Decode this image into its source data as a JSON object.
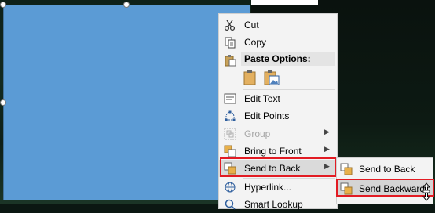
{
  "menu": {
    "cut": "Cut",
    "copy": "Copy",
    "paste_options": "Paste Options:",
    "edit_text": "Edit Text",
    "edit_points": "Edit Points",
    "group": "Group",
    "bring_to_front": "Bring to Front",
    "send_to_back": "Send to Back",
    "hyperlink": "Hyperlink...",
    "smart_lookup": "Smart Lookup"
  },
  "submenu": {
    "send_to_back": "Send to Back",
    "send_backward": "Send Backward"
  },
  "colors": {
    "shape_fill": "#5b9bd5",
    "highlight_red": "#e21b23",
    "menu_bg": "#f3f3f3"
  }
}
